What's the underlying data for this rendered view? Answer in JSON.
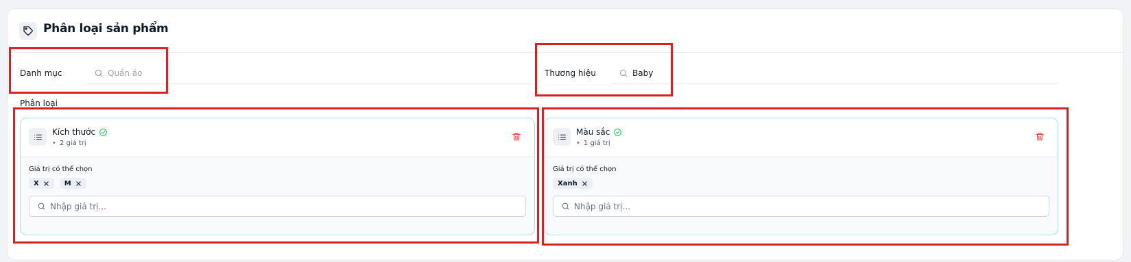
{
  "section": {
    "title": "Phân loại sản phẩm",
    "icon": "tag-icon"
  },
  "category": {
    "label": "Danh mục",
    "placeholder": "Quần áo",
    "value": ""
  },
  "brand": {
    "label": "Thương hiệu",
    "value": "Baby"
  },
  "classification_label": "Phân loại",
  "variants": [
    {
      "name": "Kích thước",
      "count": "2 giá trị",
      "available_label": "Giá trị có thể chọn",
      "values": [
        "X",
        "M"
      ],
      "input_placeholder": "Nhập giá trị..."
    },
    {
      "name": "Màu sắc",
      "count": "1 giá trị",
      "available_label": "Giá trị có thể chọn",
      "values": [
        "Xanh"
      ],
      "input_placeholder": "Nhập giá trị..."
    }
  ],
  "colors": {
    "accent_border": "#a5e0ec",
    "check": "#22c55e",
    "delete": "#ef4444",
    "highlight": "#dc1f1f"
  }
}
